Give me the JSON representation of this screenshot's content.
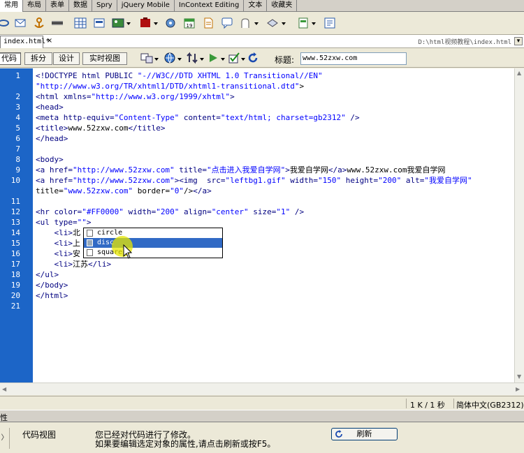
{
  "insert_tabs": [
    "常用",
    "布局",
    "表单",
    "数据",
    "Spry",
    "jQuery Mobile",
    "InContext Editing",
    "文本",
    "收藏夹"
  ],
  "document": {
    "tab_label": "index.html*",
    "close_glyph": "×",
    "path": "D:\\html视频教程\\index.html",
    "path_button": "▾"
  },
  "view_buttons": {
    "code": "代码",
    "split": "拆分",
    "design": "设计",
    "live": "实时视图"
  },
  "title_field": {
    "label": "标题:",
    "value": "www.52zxw.com"
  },
  "code_lines": [
    {
      "n": "1",
      "text": "<!DOCTYPE html PUBLIC \"-//W3C//DTD XHTML 1.0 Transitional//EN\""
    },
    {
      "n": "",
      "text": "\"http://www.w3.org/TR/xhtml1/DTD/xhtml1-transitional.dtd\">"
    },
    {
      "n": "2",
      "text": "<html xmlns=\"http://www.w3.org/1999/xhtml\">"
    },
    {
      "n": "3",
      "text": "<head>"
    },
    {
      "n": "4",
      "text": "<meta http-equiv=\"Content-Type\" content=\"text/html; charset=gb2312\" />"
    },
    {
      "n": "5",
      "text": "<title>www.52zxw.com</title>"
    },
    {
      "n": "6",
      "text": "</head>"
    },
    {
      "n": "7",
      "text": ""
    },
    {
      "n": "8",
      "text": "<body>"
    },
    {
      "n": "9",
      "text": "<a href=\"http://www.52zxw.com\" title=\"点击进入我爱自学网\">我爱自学网</a>www.52zxw.com我爱自学网"
    },
    {
      "n": "10",
      "text": "<a href=\"http://www.52zxw.com\"><img  src=\"leftbg1.gif\" width=\"150\" height=\"200\" alt=\"我爱自学网\""
    },
    {
      "n": "",
      "text": "title=\"www.52zxw.com\" border=\"0\"/></a>"
    },
    {
      "n": "11",
      "text": ""
    },
    {
      "n": "12",
      "text": "<hr color=\"#FF0000\" width=\"200\" align=\"center\" size=\"1\" />"
    },
    {
      "n": "13",
      "text": "<ul type=\"\">"
    },
    {
      "n": "14",
      "text": "    <li>北"
    },
    {
      "n": "15",
      "text": "    <li>上"
    },
    {
      "n": "16",
      "text": "    <li>安"
    },
    {
      "n": "17",
      "text": "    <li>江苏</li>"
    },
    {
      "n": "18",
      "text": "</ul>"
    },
    {
      "n": "19",
      "text": "</body>"
    },
    {
      "n": "20",
      "text": "</html>"
    },
    {
      "n": "21",
      "text": ""
    }
  ],
  "code_hint": {
    "items": [
      "circle",
      "disc",
      "square"
    ],
    "selected": "disc"
  },
  "status": {
    "size": "1 K / 1 秒",
    "encoding": "简体中文(GB2312)"
  },
  "properties": {
    "header": "性",
    "view_label": "代码视图",
    "message_line1": "您已经对代码进行了修改。",
    "message_line2": "如果要编辑选定对象的属性,请点击刷新或按F5。",
    "refresh_label": "刷新",
    "toggle_glyph": "〉"
  },
  "colors": {
    "gutter": "#1c65c7",
    "selection": "#316ac5",
    "cursor_highlight": "#e6e600"
  }
}
